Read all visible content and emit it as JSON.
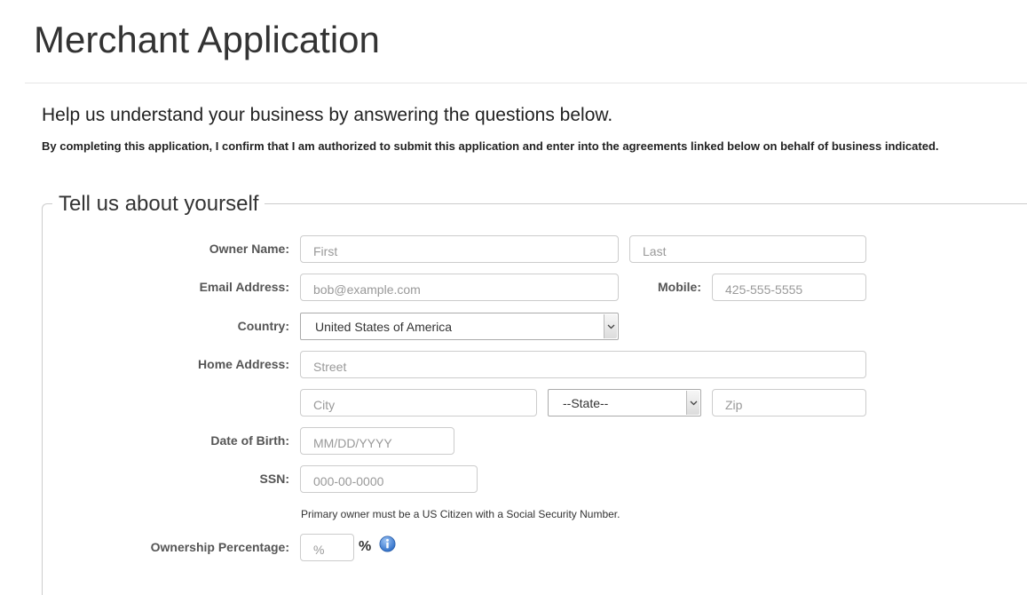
{
  "header": {
    "title": "Merchant Application"
  },
  "intro": {
    "heading": "Help us understand your business by answering the questions below.",
    "confirmation": "By completing this application, I confirm that I am authorized to submit this application and enter into the agreements linked below on behalf of business indicated."
  },
  "section": {
    "legend": "Tell us about yourself",
    "owner_name": {
      "label": "Owner Name:",
      "first_placeholder": "First",
      "last_placeholder": "Last"
    },
    "email": {
      "label": "Email Address:",
      "placeholder": "bob@example.com"
    },
    "mobile": {
      "label": "Mobile:",
      "placeholder": "425-555-5555"
    },
    "country": {
      "label": "Country:",
      "selected": "United States of America"
    },
    "home_address": {
      "label": "Home Address:",
      "street_placeholder": "Street",
      "city_placeholder": "City",
      "state_selected": "--State--",
      "zip_placeholder": "Zip"
    },
    "dob": {
      "label": "Date of Birth:",
      "placeholder": "MM/DD/YYYY"
    },
    "ssn": {
      "label": "SSN:",
      "placeholder": "000-00-0000",
      "help": "Primary owner must be a US Citizen with a Social Security Number."
    },
    "ownership": {
      "label": "Ownership Percentage:",
      "placeholder": "%",
      "suffix": "%"
    }
  },
  "icons": {
    "info": "info-icon",
    "dropdown": "chevron-down-icon"
  },
  "colors": {
    "info_icon": "#3a7fd5",
    "border": "#cccccc"
  }
}
